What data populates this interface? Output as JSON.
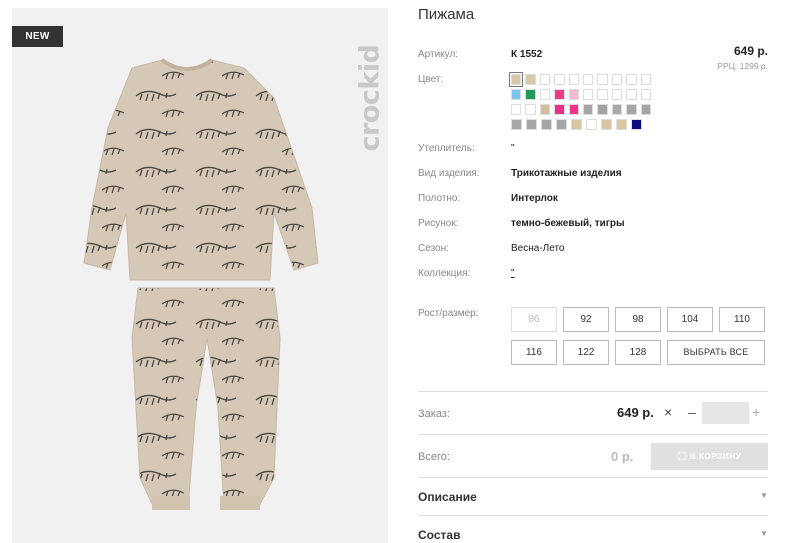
{
  "product": {
    "badge": "NEW",
    "brand": "crockid",
    "title": "Пижама"
  },
  "details": {
    "sku_label": "Артикул:",
    "sku": "К 1552",
    "price": "649 р.",
    "rrp": "РРЦ: 1299 р.",
    "color_label": "Цвет:",
    "insulation_label": "Утеплитель:",
    "insulation": "\"",
    "type_label": "Вид изделия:",
    "type": "Трикотажные изделия",
    "fabric_label": "Полотно:",
    "fabric": "Интерлок",
    "pattern_label": "Рисунок:",
    "pattern": "темно-бежевый, тигры",
    "season_label": "Сезон:",
    "season": "Весна-Лето",
    "collection_label": "Коллекция:",
    "collection": "\"",
    "size_label": "Рост/размер:"
  },
  "swatch_colors": [
    [
      "#d8c6a4",
      "#d9c9ab",
      "#ffffff",
      "#ffffff",
      "#ffffff",
      "#ffffff",
      "#ffffff",
      "#ffffff",
      "#ffffff",
      "#ffffff"
    ],
    [
      "#7cc4ec",
      "#1f9a5c",
      "#ffffff",
      "#ee3a8a",
      "#f2b9cf",
      "#ffffff",
      "#ffffff",
      "#ffffff",
      "#ffffff",
      "#ffffff"
    ],
    [
      "#ffffff",
      "#ffffff",
      "#d3bf9d",
      "#ee2f86",
      "#f0338d",
      "#a5a5a5",
      "#a3a3a3",
      "#a9a9a9",
      "#a6a6a6",
      "#a4a4a4"
    ],
    [
      "#a7a7a7",
      "#a5a5a5",
      "#a4a4a4",
      "#a6a6a6",
      "#d8c6a2",
      "#ffffff",
      "#d7c6a3",
      "#dac8a5",
      "#0c0c80"
    ]
  ],
  "sizes": {
    "row1": [
      "86",
      "92",
      "98",
      "104",
      "110"
    ],
    "row2": [
      "116",
      "122",
      "128"
    ],
    "select_all": "ВЫБРАТЬ ВСЕ"
  },
  "order": {
    "label": "Заказ:",
    "price": "649 р.",
    "times": "×",
    "minus": "–",
    "plus": "+",
    "quantity": ""
  },
  "total": {
    "label": "Всего:",
    "value": "0 р.",
    "cart_button": "В КОРЗИНУ"
  },
  "accordion": {
    "description": "Описание",
    "composition": "Состав",
    "arrow": "▼"
  }
}
